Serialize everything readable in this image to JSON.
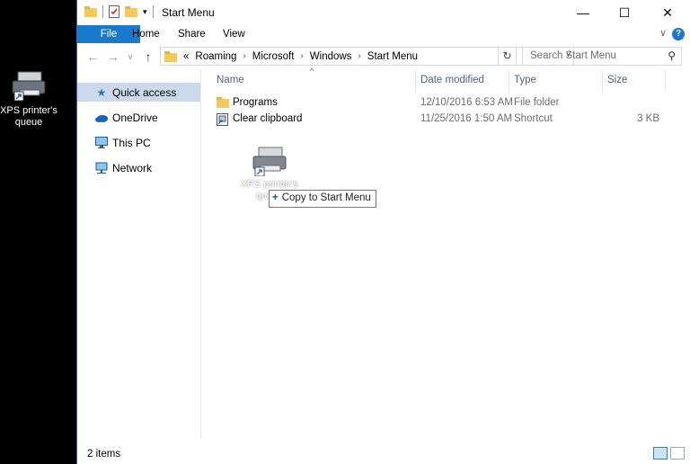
{
  "desktop": {
    "icon_label": "XPS printer's queue",
    "icon_name": "printer-icon"
  },
  "window": {
    "title": "Start Menu",
    "controls": {
      "minimize": "—",
      "maximize": "☐",
      "close": "✕"
    }
  },
  "ribbon": {
    "tabs": [
      "File",
      "Home",
      "Share",
      "View"
    ],
    "collapse_glyph": "∨",
    "help_glyph": "?"
  },
  "address": {
    "overflow": "«",
    "crumbs": [
      "Roaming",
      "Microsoft",
      "Windows",
      "Start Menu"
    ],
    "search_placeholder": "Search Start Menu"
  },
  "nav": {
    "items": [
      {
        "label": "Quick access",
        "icon": "star-icon"
      },
      {
        "label": "OneDrive",
        "icon": "cloud-icon"
      },
      {
        "label": "This PC",
        "icon": "monitor-icon"
      },
      {
        "label": "Network",
        "icon": "network-icon"
      }
    ]
  },
  "columns": {
    "name": "Name",
    "date": "Date modified",
    "type": "Type",
    "size": "Size"
  },
  "files": [
    {
      "name": "Programs",
      "date": "12/10/2016 6:53 AM",
      "type": "File folder",
      "size": "",
      "icon": "folder-icon"
    },
    {
      "name": "Clear clipboard",
      "date": "11/25/2016 1:50 AM",
      "type": "Shortcut",
      "size": "3 KB",
      "icon": "shortcut-icon"
    }
  ],
  "drag": {
    "icon_label": "XPS printer's queue",
    "tooltip": "Copy to Start Menu"
  },
  "status": {
    "items_count": "2 items"
  },
  "colors": {
    "accent": "#1979ca",
    "selection": "#ccd9ea"
  }
}
